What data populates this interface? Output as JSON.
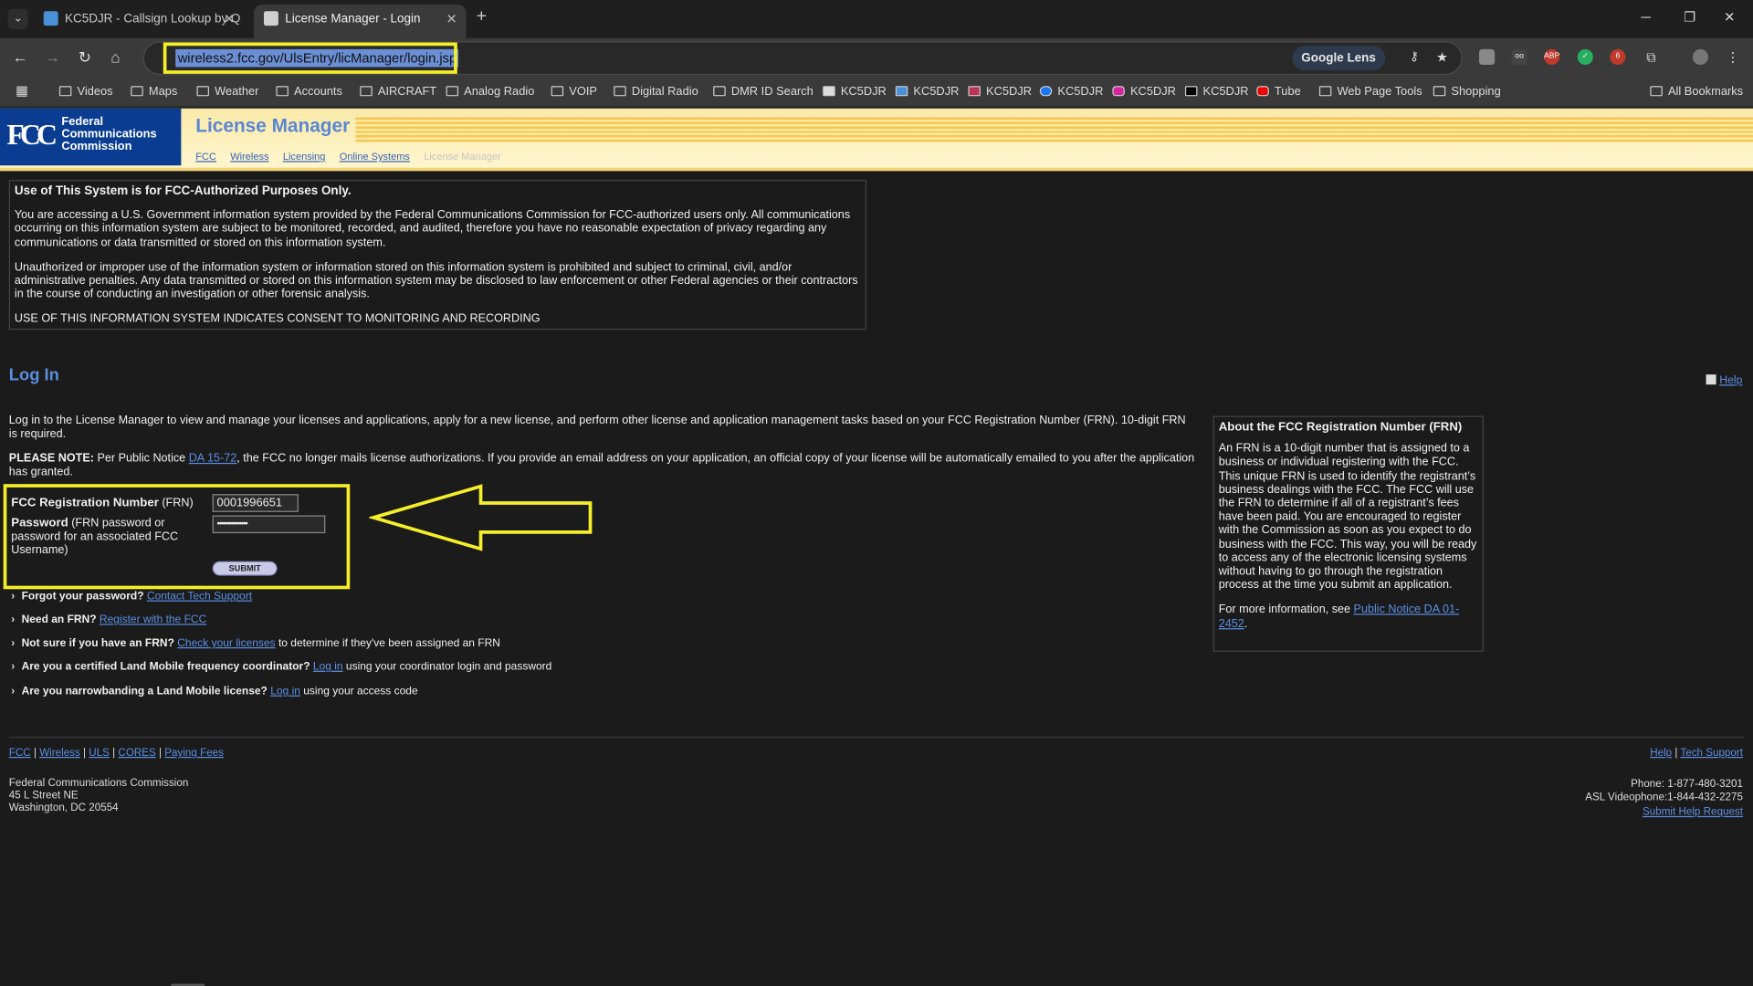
{
  "browser": {
    "tabs": [
      {
        "title": "KC5DJR - Callsign Lookup by Q"
      },
      {
        "title": "License Manager - Login"
      }
    ],
    "url": "wireless2.fcc.gov/UlsEntry/licManager/login.jsp",
    "lens_label": "Google Lens",
    "bookmarks": [
      "Videos",
      "Maps",
      "Weather",
      "Accounts",
      "AIRCRAFT",
      "Analog Radio",
      "VOIP",
      "Digital Radio",
      "DMR ID Search",
      "KC5DJR",
      "KC5DJR",
      "KC5DJR",
      "KC5DJR",
      "KC5DJR",
      "KC5DJR",
      "Tube",
      "Web Page Tools",
      "Shopping"
    ],
    "all_bookmarks": "All Bookmarks",
    "ext_badge": "6"
  },
  "header": {
    "agency": [
      "Federal",
      "Communications",
      "Commission"
    ],
    "title": "License Manager",
    "breadcrumbs": [
      "FCC",
      "Wireless",
      "Licensing",
      "Online Systems"
    ],
    "breadcrumb_current": "License Manager"
  },
  "warning": {
    "heading": "Use of This System is for FCC-Authorized Purposes Only.",
    "p1": "You are accessing a U.S. Government information system provided by the Federal Communications Commission for FCC-authorized users only. All communications occurring on this information system are subject to be monitored, recorded, and audited, therefore you have no reasonable expectation of privacy regarding any communications or data transmitted or stored on this information system.",
    "p2": "Unauthorized or improper use of the information system or information stored on this information system is prohibited and subject to criminal, civil, and/or administrative penalties. Any data transmitted or stored on this information system may be disclosed to law enforcement or other Federal agencies or their contractors in the course of conducting an investigation or other forensic analysis.",
    "p3": "USE OF THIS INFORMATION SYSTEM INDICATES CONSENT TO MONITORING AND RECORDING"
  },
  "login": {
    "heading": "Log In",
    "help": "Help",
    "intro": "Log in to the License Manager to view and manage your licenses and applications, apply for a new license, and perform other license and application management tasks based on your FCC Registration Number (FRN). 10-digit FRN is required.",
    "note_label": "PLEASE NOTE:",
    "note_pre": " Per Public Notice ",
    "note_link": "DA 15-72",
    "note_post": ", the FCC no longer mails license authorizations. If you provide an email address on your application, an official copy of your license will be automatically emailed to you after the application has granted.",
    "frn_label": "FCC Registration Number",
    "frn_suffix": " (FRN)",
    "frn_value": "0001996651",
    "pw_label": "Password",
    "pw_hint": " (FRN password or password for an associated FCC Username)",
    "pw_value": "•••••••••••••••",
    "submit": "SUBMIT"
  },
  "help_links": [
    {
      "q": "Forgot your password?",
      "link": "Contact Tech Support",
      "after": ""
    },
    {
      "q": "Need an FRN?",
      "link": "Register with the FCC",
      "after": ""
    },
    {
      "q": "Not sure if you have an FRN?",
      "link": "Check your licenses",
      "after": " to determine if they've been assigned an FRN"
    },
    {
      "q": "Are you a certified Land Mobile frequency coordinator?",
      "link": "Log in",
      "after": " using your coordinator login and password"
    },
    {
      "q": "Are you narrowbanding a Land Mobile license?",
      "link": "Log in",
      "after": " using your access code"
    }
  ],
  "frn_info": {
    "heading": "About the FCC Registration Number (FRN)",
    "body": "An FRN is a 10-digit number that is assigned to a business or individual registering with the FCC. This unique FRN is used to identify the registrant’s business dealings with the FCC. The FCC will use the FRN to determine if all of a registrant’s fees have been paid. You are encouraged to register with the Commission as soon as you expect to do business with the FCC. This way, you will be ready to access any of the electronic licensing systems without having to go through the registration process at the time you submit an application.",
    "more_pre": "For more information, see ",
    "more_link": "Public Notice DA 01-2452",
    "more_post": "."
  },
  "footer": {
    "links": [
      "FCC",
      "Wireless",
      "ULS",
      "CORES",
      "Paying Fees"
    ],
    "right_links": [
      "Help",
      "Tech Support"
    ],
    "address": [
      "Federal Communications Commission",
      "45 L Street NE",
      "Washington, DC 20554"
    ],
    "phone": "Phone: 1-877-480-3201",
    "asl": "ASL Videophone:1-844-432-2275",
    "submit_help": "Submit Help Request"
  },
  "colors": {
    "highlight": "#f5ef2a",
    "fcc_blue": "#0a3d91",
    "link": "#5b8fe4"
  }
}
